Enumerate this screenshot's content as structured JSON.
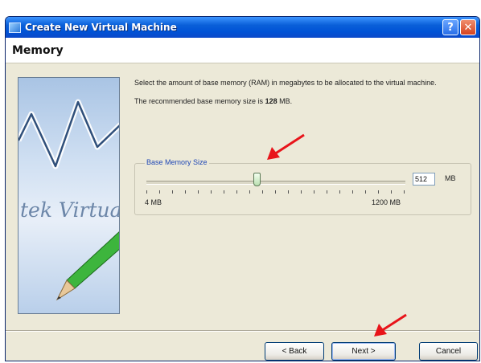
{
  "window": {
    "title": "Create New Virtual Machine",
    "help_label": "?",
    "close_label": "✕"
  },
  "header": {
    "title": "Memory"
  },
  "banner": {
    "text": "tek Virtua"
  },
  "content": {
    "description": "Select the amount of base memory (RAM) in megabytes to be allocated to the virtual machine.",
    "recommended_prefix": "The recommended base memory size is ",
    "recommended_value": "128",
    "recommended_suffix": " MB."
  },
  "memory": {
    "group_label": "Base Memory Size",
    "min_label": "4 MB",
    "max_label": "1200 MB",
    "value": "512",
    "unit": "MB",
    "slider_min": 4,
    "slider_max": 1200,
    "slider_value": 512
  },
  "buttons": {
    "back": "< Back",
    "next": "Next >",
    "cancel": "Cancel"
  },
  "colors": {
    "titlebar": "#0053d6",
    "annotation_arrow": "#e8141a",
    "group_label": "#1f47b5"
  }
}
